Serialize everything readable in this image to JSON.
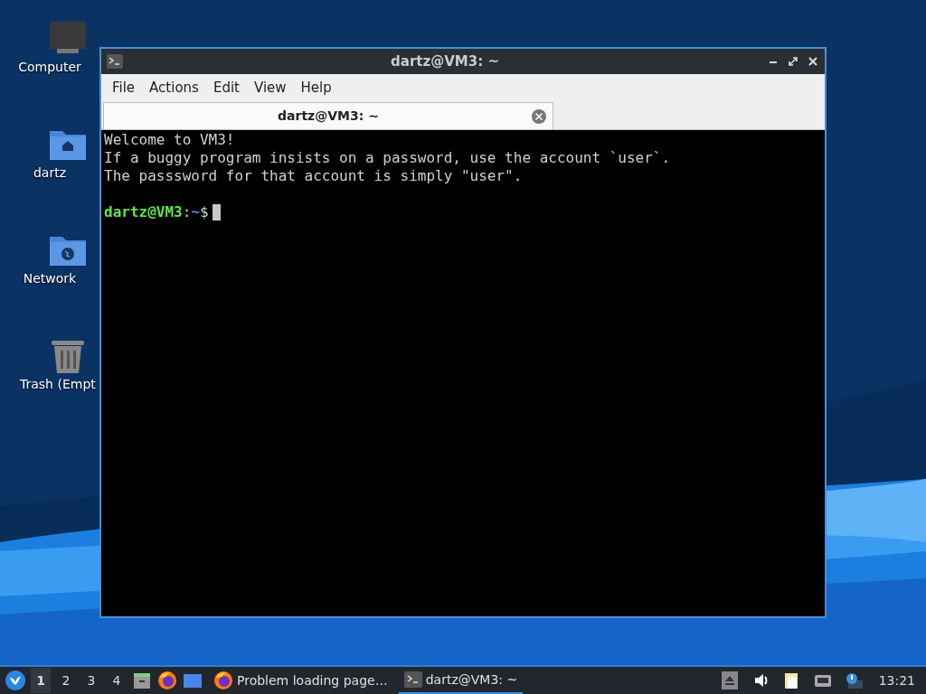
{
  "desktop_icons": [
    {
      "label": "Computer",
      "kind": "computer"
    },
    {
      "label": "dartz",
      "kind": "home"
    },
    {
      "label": "Network",
      "kind": "network"
    },
    {
      "label": "Trash (Empt",
      "kind": "trash"
    }
  ],
  "window": {
    "title": "dartz@VM3: ~",
    "menu": [
      "File",
      "Actions",
      "Edit",
      "View",
      "Help"
    ],
    "tabs": [
      {
        "label": "dartz@VM3: ~",
        "selected": true
      }
    ],
    "terminal": {
      "lines": [
        "Welcome to VM3!",
        "If a buggy program insists on a password, use the account `user`.",
        "The passsword for that account is simply \"user\"."
      ],
      "prompt": {
        "user_host": "dartz@VM3",
        "separator": ":",
        "path": "~",
        "symbol": "$"
      }
    }
  },
  "taskbar": {
    "workspaces": [
      {
        "label": "1",
        "selected": true
      },
      {
        "label": "2",
        "selected": false
      },
      {
        "label": "3",
        "selected": false
      },
      {
        "label": "4",
        "selected": false
      }
    ],
    "launchers": [
      {
        "kind": "files"
      },
      {
        "kind": "firefox"
      },
      {
        "kind": "desktop"
      }
    ],
    "tasks": [
      {
        "label": "Problem loading page…",
        "kind": "firefox",
        "selected": false
      },
      {
        "label": "dartz@VM3: ~",
        "kind": "terminal",
        "selected": true
      }
    ],
    "tray": [
      {
        "kind": "eject"
      },
      {
        "kind": "volume"
      },
      {
        "kind": "clipboard"
      },
      {
        "kind": "network"
      },
      {
        "kind": "notification"
      }
    ],
    "clock": "13:21"
  }
}
